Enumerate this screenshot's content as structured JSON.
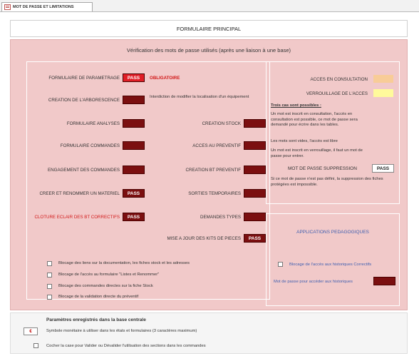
{
  "tab": {
    "label": "MOT DE PASSE ET LIMITATIONS"
  },
  "header": {
    "title": "FORMULAIRE PRINCIPAL"
  },
  "main": {
    "subtitle": "Vérification des mots de passe utilisés (après une liaison à une base)",
    "left": {
      "formulaire_parametrage": {
        "label": "FORMULAIRE DE PARAMETRAGE",
        "value": "PASS",
        "note": "OBLIGATOIRE"
      },
      "creation_arborescence": {
        "label": "CREATION DE L'ARBORESCENCE",
        "value": "",
        "note": "Interdiction de modifier la localisation d'un équipement"
      },
      "formulaire_analyses": {
        "label": "FORMULAIRE ANALYSES",
        "value": ""
      },
      "creation_stock": {
        "label": "CREATION STOCK",
        "value": ""
      },
      "formulaire_commandes": {
        "label": "FORMULAIRE COMMANDES",
        "value": ""
      },
      "acces_preventif": {
        "label": "ACCES AU PREVENTIF",
        "value": ""
      },
      "engagement_commandes": {
        "label": "ENGAGEMENT DES COMMANDES",
        "value": ""
      },
      "creation_bt_preventif": {
        "label": "CREATION BT PREVENTIF",
        "value": ""
      },
      "creer_renommer": {
        "label": "CREER ET RENOMMER UN MATERIEL",
        "value": "PASS"
      },
      "sorties_temporaires": {
        "label": "SORTIES TEMPORAIRES",
        "value": ""
      },
      "cloture_eclair": {
        "label": "CLOTURE ECLAIR DES BT CORRECTIFS",
        "value": "PASS"
      },
      "demandes_types": {
        "label": "DEMANDES TYPES",
        "value": ""
      },
      "mise_a_jour_kits": {
        "label": "MISE A JOUR DES KITS DE PIECES",
        "value": "PASS"
      },
      "checkboxes": [
        "Blocage des liens sur la documentation, les fiches stock et les adresses",
        "Blocage de l'accès au formulaire \"Listes et Renommer\"",
        "Blocage des commandes directes sur la fiche Stock",
        "Blocage de la validation directe du préventif"
      ]
    },
    "right_top": {
      "acces_consultation": {
        "label": "ACCES EN CONSULTATION",
        "color": "#f8cc97"
      },
      "verrouillage_acces": {
        "label": "VERROUILLAGE DE L'ACCES",
        "color": "#fffa9b"
      },
      "trois_cas": "Trois cas sont possibles :",
      "note1": "Un mot est inscrit en consultation, l'accès en consultation est possible, ce mot de passe sera demandé pour écrire dans les tables.",
      "note2": "Les mots sont vides, l'accès est libre",
      "note3": "Un mot est inscrit en verrouillage, il faut un mot de passe pour entrer.",
      "mdp_suppression": {
        "label": "MOT DE PASSE SUPPRESSION",
        "value": "PASS"
      },
      "note4": "Si ce mot de passe n'est pas défini, la suppression des fiches protégées est impossible."
    },
    "right_bottom": {
      "title": "APPLICATIONS PEDAGOGIQUES",
      "checkbox_label": "Blocage de l'accès aux historiques Correctifs",
      "mdp_label": "Mot de passe pour accéder aux historiques",
      "mdp_value": ""
    }
  },
  "footer": {
    "title": "Paramètres enregistrés dans la base centrale",
    "currency_symbol": "€",
    "currency_label": "Symbole monétaire à utiliser dans les états et formulaires (3 caractères maximum)",
    "checkbox_label": "Cocher la case pour Valider ou Dévalider l'utilisation des sections dans les commandes"
  },
  "colors": {
    "panel_bg": "#f1c9c9",
    "field_dark": "#7b0f10",
    "field_bright": "#e01e26"
  }
}
